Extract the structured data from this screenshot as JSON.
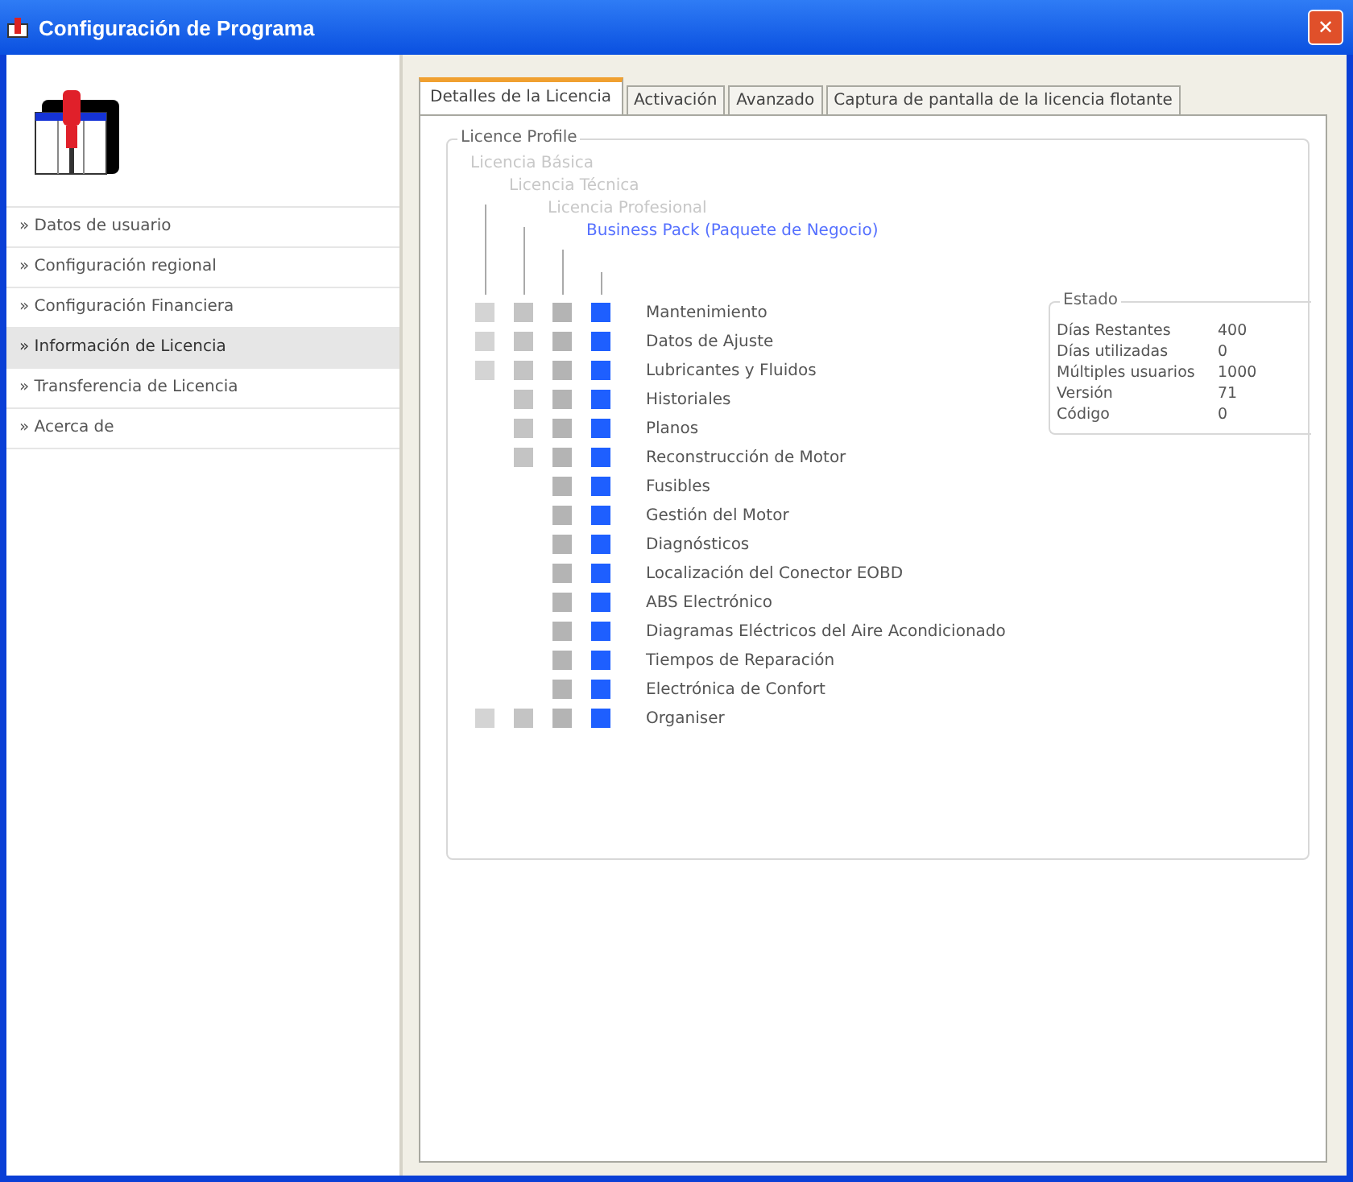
{
  "window": {
    "title": "Configuración de Programa",
    "close_glyph": "✕"
  },
  "sidebar": {
    "items": [
      {
        "label": "» Datos de usuario",
        "selected": false
      },
      {
        "label": "» Configuración regional",
        "selected": false
      },
      {
        "label": "» Configuración Financiera",
        "selected": false
      },
      {
        "label": "» Información de Licencia",
        "selected": true
      },
      {
        "label": "» Transferencia de Licencia",
        "selected": false
      },
      {
        "label": "» Acerca de",
        "selected": false
      }
    ]
  },
  "tabs": [
    {
      "label": "Detalles de la Licencia",
      "selected": true
    },
    {
      "label": "Activación",
      "selected": false
    },
    {
      "label": "Avanzado",
      "selected": false
    },
    {
      "label": "Captura de pantalla de la licencia flotante",
      "selected": false
    }
  ],
  "licence_profile": {
    "title": "Licence Profile",
    "tiers": [
      {
        "label": "Licencia Básica",
        "selected": false,
        "color": "#d4d4d4"
      },
      {
        "label": "Licencia Técnica",
        "selected": false,
        "color": "#c4c4c4"
      },
      {
        "label": "Licencia Profesional",
        "selected": false,
        "color": "#b4b4b4"
      },
      {
        "label": "Business Pack (Paquete de Negocio)",
        "selected": true,
        "color": "#1e5fff"
      }
    ],
    "features": [
      {
        "label": "Mantenimiento",
        "included": [
          true,
          true,
          true,
          true
        ]
      },
      {
        "label": "Datos de Ajuste",
        "included": [
          true,
          true,
          true,
          true
        ]
      },
      {
        "label": "Lubricantes y Fluidos",
        "included": [
          true,
          true,
          true,
          true
        ]
      },
      {
        "label": "Historiales",
        "included": [
          false,
          true,
          true,
          true
        ]
      },
      {
        "label": "Planos",
        "included": [
          false,
          true,
          true,
          true
        ]
      },
      {
        "label": "Reconstrucción de Motor",
        "included": [
          false,
          true,
          true,
          true
        ]
      },
      {
        "label": "Fusibles",
        "included": [
          false,
          false,
          true,
          true
        ]
      },
      {
        "label": "Gestión del Motor",
        "included": [
          false,
          false,
          true,
          true
        ]
      },
      {
        "label": "Diagnósticos",
        "included": [
          false,
          false,
          true,
          true
        ]
      },
      {
        "label": "Localización del Conector EOBD",
        "included": [
          false,
          false,
          true,
          true
        ]
      },
      {
        "label": "ABS Electrónico",
        "included": [
          false,
          false,
          true,
          true
        ]
      },
      {
        "label": "Diagramas Eléctricos del Aire Acondicionado",
        "included": [
          false,
          false,
          true,
          true
        ]
      },
      {
        "label": "Tiempos de Reparación",
        "included": [
          false,
          false,
          true,
          true
        ]
      },
      {
        "label": "Electrónica de Confort",
        "included": [
          false,
          false,
          true,
          true
        ]
      },
      {
        "label": "Organiser",
        "included": [
          true,
          true,
          true,
          true
        ]
      }
    ]
  },
  "estado": {
    "title": "Estado",
    "rows": [
      {
        "label": "Días Restantes",
        "value": "400"
      },
      {
        "label": "Días utilizadas",
        "value": "0"
      },
      {
        "label": "Múltiples usuarios",
        "value": "1000"
      },
      {
        "label": "Versión",
        "value": "71"
      },
      {
        "label": "Código",
        "value": "0"
      }
    ]
  }
}
